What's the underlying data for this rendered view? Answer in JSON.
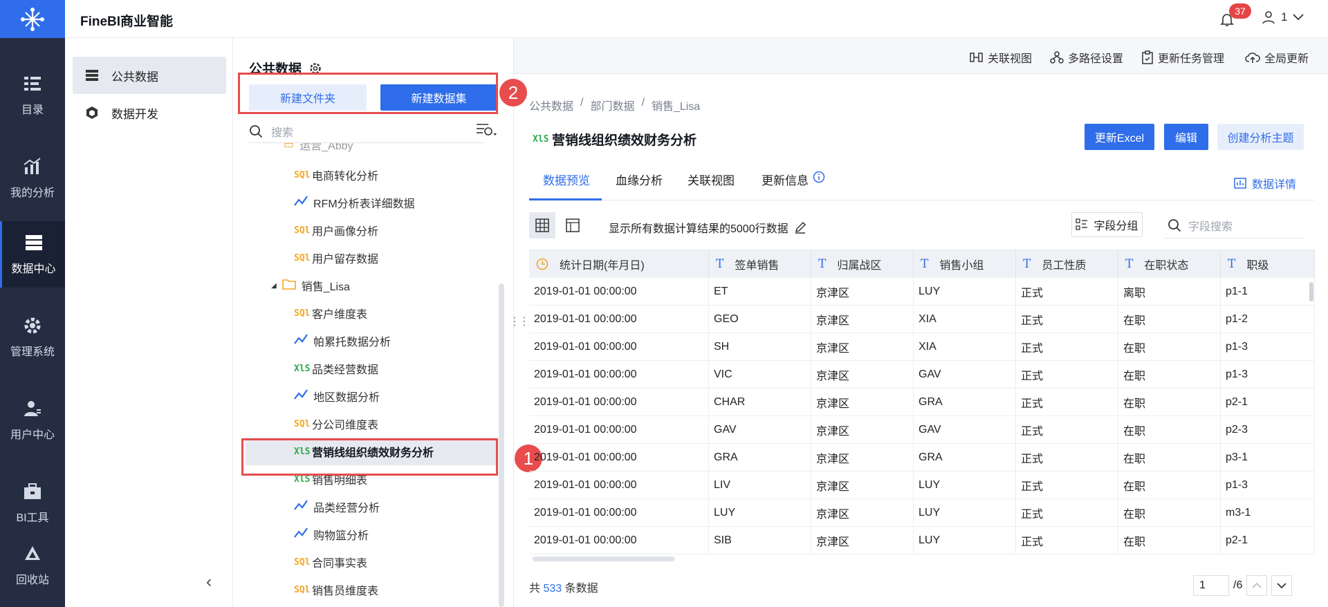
{
  "header": {
    "app_title": "FineBI商业智能",
    "notification_count": "37",
    "user_name": "1"
  },
  "leftnav": [
    {
      "label": "目录",
      "icon": "catalog-icon"
    },
    {
      "label": "我的分析",
      "icon": "analysis-icon"
    },
    {
      "label": "数据中心",
      "icon": "data-center-icon",
      "active": true
    },
    {
      "label": "管理系统",
      "icon": "gear-icon"
    },
    {
      "label": "用户中心",
      "icon": "user-icon"
    },
    {
      "label": "BI工具",
      "icon": "toolbox-icon"
    },
    {
      "label": "回收站",
      "icon": "recycle-icon"
    }
  ],
  "sidebar": {
    "public_data": "公共数据",
    "data_dev": "数据开发"
  },
  "tree_panel": {
    "title": "公共数据",
    "new_folder": "新建文件夹",
    "new_dataset": "新建数据集",
    "search_placeholder": "搜索",
    "partial_folder": "运营_Abby",
    "items": [
      {
        "label": "电商转化分析",
        "type": "sql"
      },
      {
        "label": "RFM分析表详细数据",
        "type": "analysis"
      },
      {
        "label": "用户画像分析",
        "type": "sql"
      },
      {
        "label": "用户留存数据",
        "type": "sql"
      },
      {
        "label": "销售_Lisa",
        "type": "folder"
      },
      {
        "label": "客户维度表",
        "type": "sql"
      },
      {
        "label": "帕累托数据分析",
        "type": "analysis"
      },
      {
        "label": "品类经营数据",
        "type": "xls"
      },
      {
        "label": "地区数据分析",
        "type": "analysis"
      },
      {
        "label": "分公司维度表",
        "type": "sql"
      },
      {
        "label": "营销线组织绩效财务分析",
        "type": "xls",
        "selected": true
      },
      {
        "label": "销售明细表",
        "type": "xls"
      },
      {
        "label": "品类经营分析",
        "type": "analysis"
      },
      {
        "label": "购物篮分析",
        "type": "analysis"
      },
      {
        "label": "合同事实表",
        "type": "sql"
      },
      {
        "label": "销售员维度表",
        "type": "sql"
      }
    ]
  },
  "markers": {
    "one": "1",
    "two": "2"
  },
  "toolbar": {
    "relation_view": "关联视图",
    "multipath": "多路径设置",
    "update_task": "更新任务管理",
    "global_update": "全局更新"
  },
  "breadcrumb": {
    "b1": "公共数据",
    "b2": "部门数据",
    "b3": "销售_Lisa",
    "sep": "/"
  },
  "dataset": {
    "title": "营销线组织绩效财务分析",
    "update_excel": "更新Excel",
    "edit": "编辑",
    "create_topic": "创建分析主题"
  },
  "tabs": {
    "preview": "数据预览",
    "lineage": "血缘分析",
    "relation": "关联视图",
    "update_info": "更新信息",
    "data_detail": "数据详情"
  },
  "preview": {
    "desc": "显示所有数据计算结果的5000行数据",
    "field_group": "字段分组",
    "field_search_placeholder": "字段搜索"
  },
  "table": {
    "headers": [
      "统计日期(年月日)",
      "签单销售",
      "归属战区",
      "销售小组",
      "员工性质",
      "在职状态",
      "职级"
    ],
    "rows": [
      [
        "2019-01-01 00:00:00",
        "ET",
        "京津区",
        "LUY",
        "正式",
        "离职",
        "p1-1"
      ],
      [
        "2019-01-01 00:00:00",
        "GEO",
        "京津区",
        "XIA",
        "正式",
        "在职",
        "p1-2"
      ],
      [
        "2019-01-01 00:00:00",
        "SH",
        "京津区",
        "XIA",
        "正式",
        "在职",
        "p1-3"
      ],
      [
        "2019-01-01 00:00:00",
        "VIC",
        "京津区",
        "GAV",
        "正式",
        "在职",
        "p1-3"
      ],
      [
        "2019-01-01 00:00:00",
        "CHAR",
        "京津区",
        "GRA",
        "正式",
        "在职",
        "p2-1"
      ],
      [
        "2019-01-01 00:00:00",
        "GAV",
        "京津区",
        "GAV",
        "正式",
        "在职",
        "p2-3"
      ],
      [
        "2019-01-01 00:00:00",
        "GRA",
        "京津区",
        "GRA",
        "正式",
        "在职",
        "p3-1"
      ],
      [
        "2019-01-01 00:00:00",
        "LIV",
        "京津区",
        "LUY",
        "正式",
        "在职",
        "p1-3"
      ],
      [
        "2019-01-01 00:00:00",
        "LUY",
        "京津区",
        "LUY",
        "正式",
        "在职",
        "m3-1"
      ],
      [
        "2019-01-01 00:00:00",
        "SIB",
        "京津区",
        "LUY",
        "正式",
        "在职",
        "p2-1"
      ]
    ]
  },
  "footer": {
    "prefix": "共",
    "count": "533",
    "suffix": "条数据",
    "page": "1",
    "total_pages": "/6"
  },
  "colors": {
    "accent": "#2f6dea",
    "nav_bg": "#252d42",
    "highlight_red": "#e84c4c"
  }
}
